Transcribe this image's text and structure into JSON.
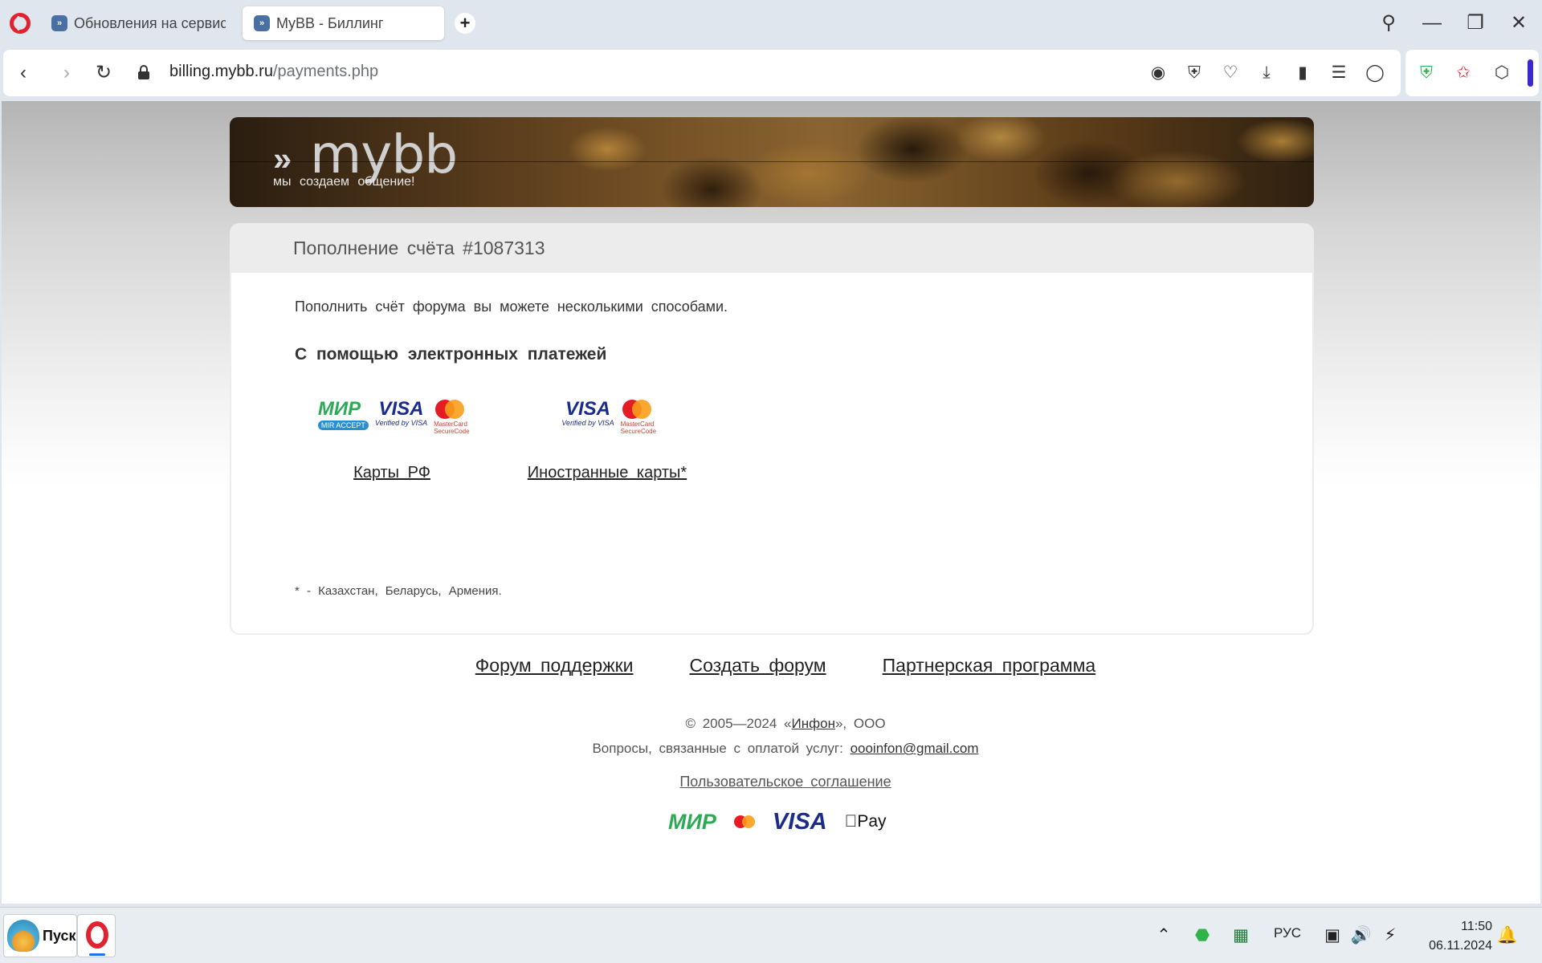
{
  "browser": {
    "tabs": [
      {
        "title": "Обновления на сервисе",
        "active": false
      },
      {
        "title": "MyBB - Биллинг",
        "active": true
      }
    ],
    "new_tab_icon": "plus-icon",
    "url_host": "billing.mybb.ru",
    "url_path": "/payments.php"
  },
  "banner": {
    "logo_mark": "»",
    "logo_text": "mybb",
    "slogan": "мы создаем общение!"
  },
  "panel": {
    "title": "Пополнение счёта #1087313",
    "lead": "Пополнить счёт форума вы можете несколькими способами.",
    "section_title": "С помощью электронных платежей",
    "options": [
      {
        "label": "Карты РФ",
        "logos": [
          "МИР",
          "VISA",
          "mastercard"
        ]
      },
      {
        "label": "Иностранные карты*",
        "logos": [
          "VISA",
          "mastercard"
        ]
      }
    ],
    "logo_sub": {
      "mir": "MIR ACCEPT",
      "visa": "Verified by VISA",
      "mc": "MasterCard SecureCode"
    },
    "footnote": "* - Казахстан, Беларусь, Армения."
  },
  "footer": {
    "links": [
      "Форум поддержки",
      "Создать форум",
      "Партнерская программа"
    ],
    "copyright_prefix": "© 2005—2024 «",
    "copyright_link": "Инфон",
    "copyright_suffix": "», ООО",
    "questions_label": "Вопросы, связанные с оплатой услуг:",
    "email": "oooinfon@gmail.com",
    "agreement": "Пользовательское соглашение",
    "payment_systems": {
      "mir": "МИР",
      "visa": "VISA",
      "apple_pay": "Pay"
    }
  },
  "taskbar": {
    "start_label": "Пуск",
    "language": "РУС",
    "time": "11:50",
    "date": "06.11.2024"
  },
  "colors": {
    "opera_red": "#e0232e",
    "mir_green": "#2eaa56",
    "visa_blue": "#1a2b8c",
    "mc_red": "#e61c24",
    "mc_orange": "#f99f1b",
    "shield_green": "#2fb34a",
    "sidebar_accent": "#3b28cc"
  }
}
